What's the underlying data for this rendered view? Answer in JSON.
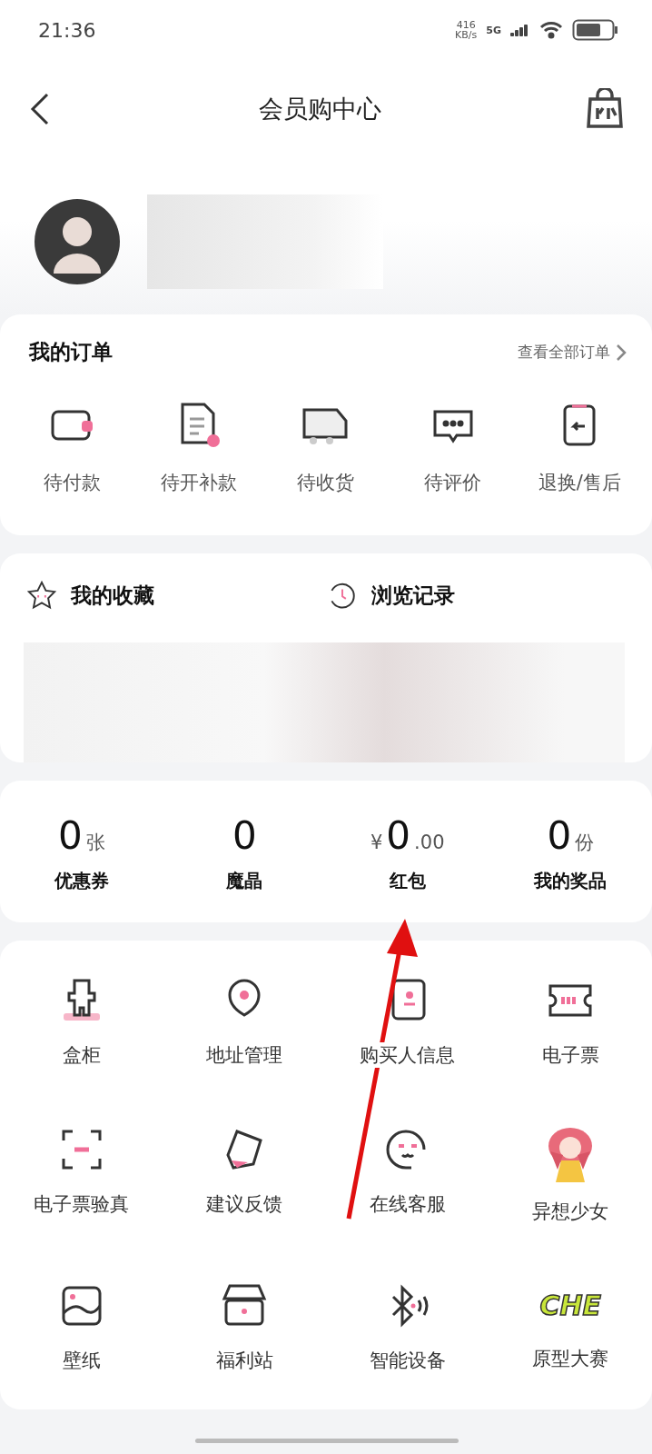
{
  "status_bar": {
    "time": "21:36",
    "speed": "416",
    "speed_unit": "KB/s",
    "network": "5G"
  },
  "header": {
    "title": "会员购中心"
  },
  "orders": {
    "title": "我的订单",
    "link": "查看全部订单",
    "items": [
      {
        "kind": "wallet",
        "label": "待付款"
      },
      {
        "kind": "document",
        "label": "待开补款"
      },
      {
        "kind": "truck",
        "label": "待收货"
      },
      {
        "kind": "chat",
        "label": "待评价"
      },
      {
        "kind": "clipboard",
        "label": "退换/售后"
      }
    ]
  },
  "history": [
    {
      "kind": "star",
      "title": "我的收藏"
    },
    {
      "kind": "clock",
      "title": "浏览记录"
    }
  ],
  "stats": [
    {
      "value": "0",
      "suffix": "张",
      "label": "优惠券"
    },
    {
      "value": "0",
      "label": "魔晶"
    },
    {
      "prefix": "¥",
      "value": "0",
      "suffix": ".00",
      "label": "红包"
    },
    {
      "value": "0",
      "suffix": "份",
      "label": "我的奖品"
    }
  ],
  "services": [
    {
      "kind": "figure",
      "label": "盒柜"
    },
    {
      "kind": "pin",
      "label": "地址管理"
    },
    {
      "kind": "contact",
      "label": "购买人信息"
    },
    {
      "kind": "ticket",
      "label": "电子票"
    },
    {
      "kind": "scan",
      "label": "电子票验真"
    },
    {
      "kind": "eraser",
      "label": "建议反馈"
    },
    {
      "kind": "support",
      "label": "在线客服"
    },
    {
      "kind": "character",
      "label": "异想少女"
    },
    {
      "kind": "wallpaper",
      "label": "壁纸"
    },
    {
      "kind": "box",
      "label": "福利站"
    },
    {
      "kind": "bluetooth",
      "label": "智能设备"
    },
    {
      "kind": "logo",
      "logo_text": "CHE",
      "label": "原型大赛"
    }
  ]
}
